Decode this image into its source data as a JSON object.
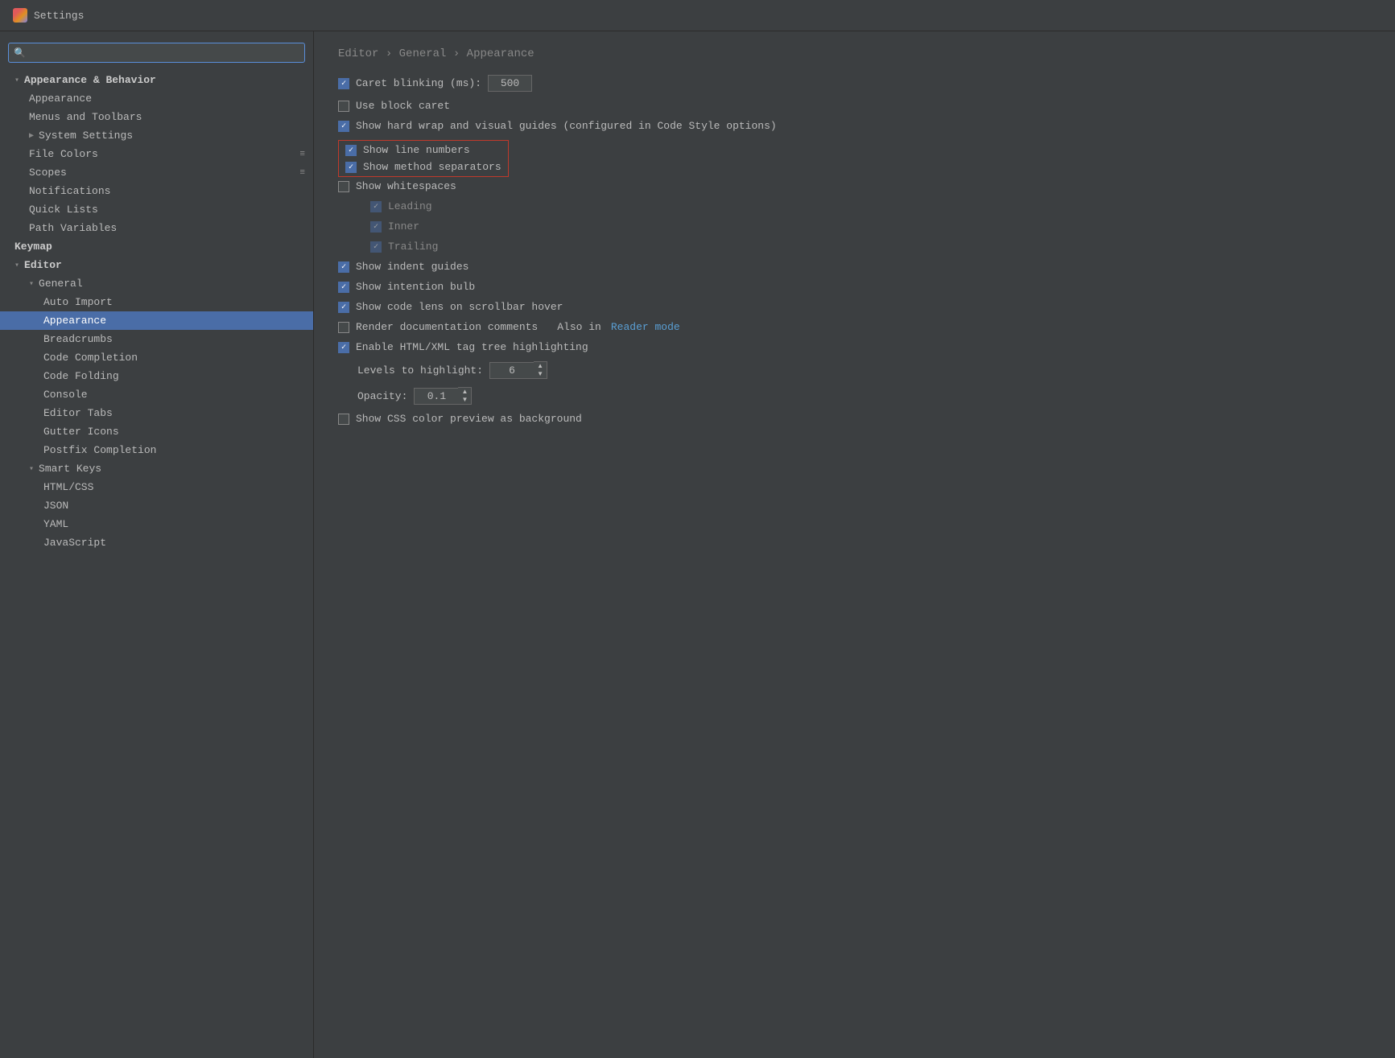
{
  "titleBar": {
    "title": "Settings"
  },
  "sidebar": {
    "searchPlaceholder": "🔍",
    "items": [
      {
        "id": "appearance-behavior",
        "label": "Appearance & Behavior",
        "level": "group-header",
        "indent": 1,
        "chevron": "▾",
        "active": false
      },
      {
        "id": "appearance",
        "label": "Appearance",
        "level": 2,
        "active": false
      },
      {
        "id": "menus-toolbars",
        "label": "Menus and Toolbars",
        "level": 2,
        "active": false
      },
      {
        "id": "system-settings",
        "label": "System Settings",
        "level": 2,
        "chevron": "▶",
        "active": false
      },
      {
        "id": "file-colors",
        "label": "File Colors",
        "level": 2,
        "icon": "≡",
        "active": false
      },
      {
        "id": "scopes",
        "label": "Scopes",
        "level": 2,
        "icon": "≡",
        "active": false
      },
      {
        "id": "notifications",
        "label": "Notifications",
        "level": 2,
        "active": false
      },
      {
        "id": "quick-lists",
        "label": "Quick Lists",
        "level": 2,
        "active": false
      },
      {
        "id": "path-variables",
        "label": "Path Variables",
        "level": 2,
        "active": false
      },
      {
        "id": "keymap",
        "label": "Keymap",
        "level": "group-header",
        "indent": 1,
        "active": false
      },
      {
        "id": "editor",
        "label": "Editor",
        "level": "group-header",
        "indent": 1,
        "chevron": "▾",
        "active": false
      },
      {
        "id": "general",
        "label": "General",
        "level": 3,
        "chevron": "▾",
        "active": false
      },
      {
        "id": "auto-import",
        "label": "Auto Import",
        "level": 4,
        "active": false
      },
      {
        "id": "appearance-editor",
        "label": "Appearance",
        "level": 4,
        "active": true
      },
      {
        "id": "breadcrumbs",
        "label": "Breadcrumbs",
        "level": 4,
        "active": false
      },
      {
        "id": "code-completion",
        "label": "Code Completion",
        "level": 4,
        "active": false
      },
      {
        "id": "code-folding",
        "label": "Code Folding",
        "level": 4,
        "active": false
      },
      {
        "id": "console",
        "label": "Console",
        "level": 4,
        "active": false
      },
      {
        "id": "editor-tabs",
        "label": "Editor Tabs",
        "level": 4,
        "active": false
      },
      {
        "id": "gutter-icons",
        "label": "Gutter Icons",
        "level": 4,
        "active": false
      },
      {
        "id": "postfix-completion",
        "label": "Postfix Completion",
        "level": 4,
        "active": false
      },
      {
        "id": "smart-keys",
        "label": "Smart Keys",
        "level": 3,
        "chevron": "▾",
        "active": false
      },
      {
        "id": "html-css",
        "label": "HTML/CSS",
        "level": 4,
        "active": false
      },
      {
        "id": "json",
        "label": "JSON",
        "level": 4,
        "active": false
      },
      {
        "id": "yaml",
        "label": "YAML",
        "level": 4,
        "active": false
      },
      {
        "id": "javascript",
        "label": "JavaScript",
        "level": 4,
        "active": false
      }
    ]
  },
  "breadcrumb": {
    "parts": [
      "Editor",
      "General",
      "Appearance"
    ]
  },
  "settings": {
    "caretBlinking": {
      "label": "Caret blinking (ms):",
      "checked": true,
      "value": "500"
    },
    "useBlockCaret": {
      "label": "Use block caret",
      "checked": false
    },
    "showHardWrap": {
      "label": "Show hard wrap and visual guides (configured in Code Style options)",
      "checked": true
    },
    "showLineNumbers": {
      "label": "Show line numbers",
      "checked": true,
      "redOutline": true
    },
    "showMethodSeparators": {
      "label": "Show method separators",
      "checked": true,
      "redOutline": true
    },
    "showWhitespaces": {
      "label": "Show whitespaces",
      "checked": false
    },
    "leading": {
      "label": "Leading",
      "checked": true,
      "disabled": true
    },
    "inner": {
      "label": "Inner",
      "checked": true,
      "disabled": true
    },
    "trailing": {
      "label": "Trailing",
      "checked": true,
      "disabled": true
    },
    "showIndentGuides": {
      "label": "Show indent guides",
      "checked": true
    },
    "showIntentionBulb": {
      "label": "Show intention bulb",
      "checked": true
    },
    "showCodeLens": {
      "label": "Show code lens on scrollbar hover",
      "checked": true
    },
    "renderDocumentation": {
      "label": "Render documentation comments",
      "checked": false,
      "also": "Also in",
      "readerMode": "Reader mode"
    },
    "enableHtmlXml": {
      "label": "Enable HTML/XML tag tree highlighting",
      "checked": true
    },
    "levelsToHighlight": {
      "label": "Levels to highlight:",
      "value": "6"
    },
    "opacity": {
      "label": "Opacity:",
      "value": "0.1"
    },
    "showCssColor": {
      "label": "Show CSS color preview as background",
      "checked": false
    }
  }
}
